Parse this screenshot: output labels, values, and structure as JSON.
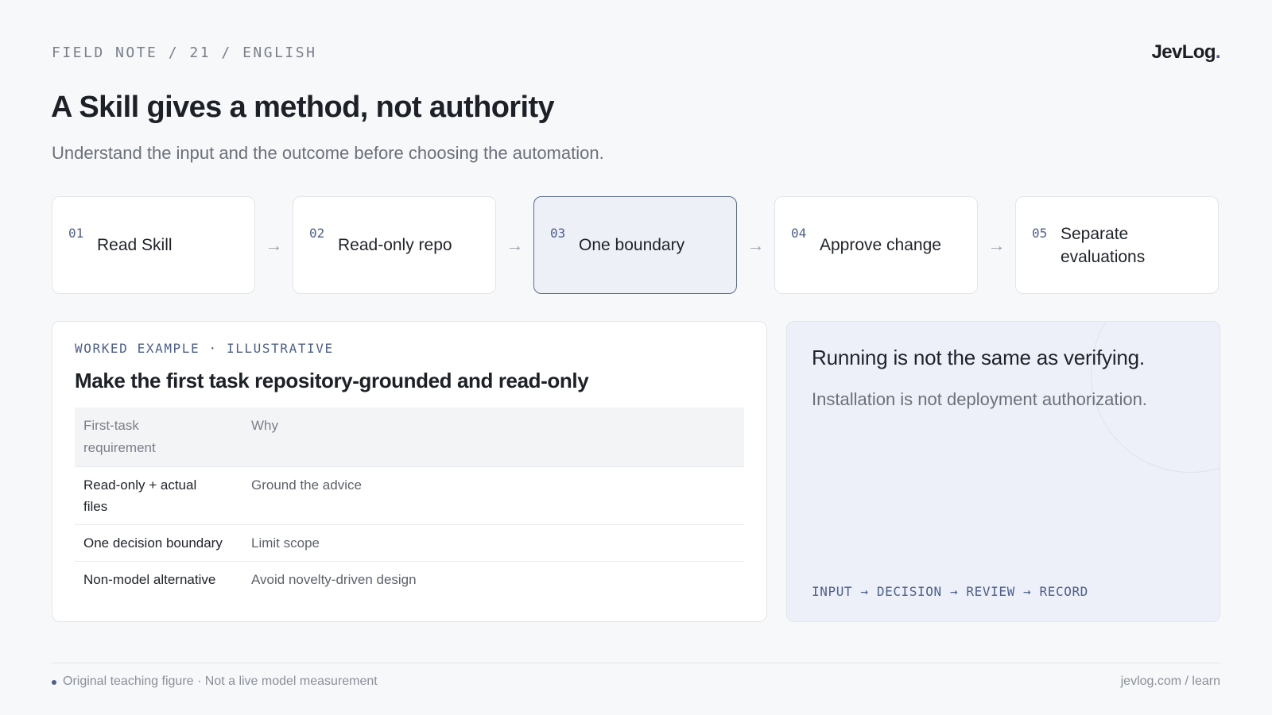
{
  "header": {
    "kicker": "FIELD NOTE / 21 / ENGLISH",
    "logo_text": "JevLog",
    "logo_dot": ".",
    "title": "A Skill gives a method, not authority",
    "subtitle": "Understand the input and the outcome before choosing the automation."
  },
  "steps": [
    {
      "num": "01",
      "label": "Read Skill",
      "active": false
    },
    {
      "num": "02",
      "label": "Read-only repo",
      "active": false
    },
    {
      "num": "03",
      "label": "One boundary",
      "active": true
    },
    {
      "num": "04",
      "label": "Approve change",
      "active": false
    },
    {
      "num": "05",
      "label": "Separate evaluations",
      "active": false
    }
  ],
  "step_arrow": "→",
  "example": {
    "kicker": "WORKED EXAMPLE · ILLUSTRATIVE",
    "title": "Make the first task repository-grounded and read-only",
    "columns": [
      "First-task requirement",
      "Why"
    ],
    "rows": [
      [
        "Read-only + actual files",
        "Ground the advice"
      ],
      [
        "One decision boundary",
        "Limit scope"
      ],
      [
        "Non-model alternative",
        "Avoid novelty-driven design"
      ]
    ]
  },
  "callout": {
    "main": "Running is not the same as verifying.",
    "sub": "Installation is not deployment authorization.",
    "flow": "INPUT → DECISION → REVIEW → RECORD"
  },
  "footer": {
    "left": "Original teaching figure · Not a live model measurement",
    "right": "jevlog.com / learn"
  },
  "colors": {
    "accent": "#4c5f8c",
    "active_step_bg": "#edf0f7",
    "callout_bg": "#edf0f8",
    "page_bg": "#f7f8fa"
  }
}
